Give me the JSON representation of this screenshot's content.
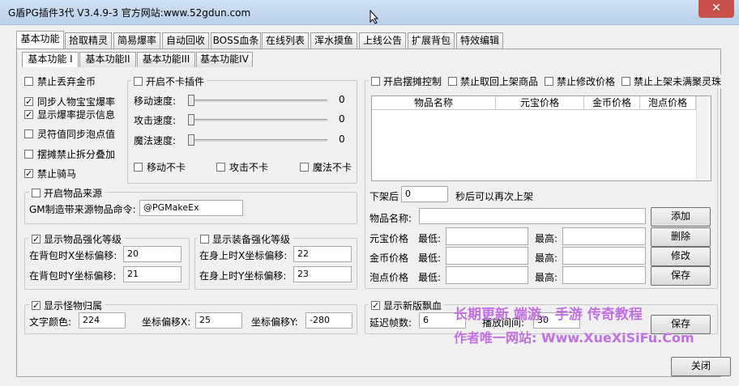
{
  "window": {
    "title": "G盾PG插件3代 V3.4.9-3  官方网站:www.52gdun.com",
    "close_label": "✕"
  },
  "main_tabs": [
    "基本功能",
    "拾取精灵",
    "简易爆率",
    "自动回收",
    "BOSS血条",
    "在线列表",
    "浑水摸鱼",
    "上线公告",
    "扩展背包",
    "特效编辑"
  ],
  "sub_tabs": [
    "基本功能 I",
    "基本功能II",
    "基本功能III",
    "基本功能IV"
  ],
  "basic_options": [
    {
      "label": "禁止丢弃金币",
      "checked": false
    },
    {
      "label": "同步人物宝宝爆率",
      "checked": true
    },
    {
      "label": "显示爆率提示信息",
      "checked": true
    },
    {
      "label": "灵符值同步泡点值",
      "checked": false
    },
    {
      "label": "摆摊禁止拆分叠加",
      "checked": false
    },
    {
      "label": "禁止骑马",
      "checked": true
    }
  ],
  "no_lag": {
    "legend": "开启不卡插件",
    "checked": false,
    "sliders": [
      {
        "label": "移动速度:",
        "value": "0"
      },
      {
        "label": "攻击速度:",
        "value": "0"
      },
      {
        "label": "魔法速度:",
        "value": "0"
      }
    ],
    "toggles": [
      {
        "label": "移动不卡",
        "checked": false
      },
      {
        "label": "攻击不卡",
        "checked": false
      },
      {
        "label": "魔法不卡",
        "checked": false
      }
    ]
  },
  "item_source": {
    "legend": "开启物品来源",
    "checked": false,
    "cmd_label": "GM制造带来源物品命令:",
    "cmd_value": "@PGMakeEx"
  },
  "item_enhance": {
    "legend": "显示物品强化等级",
    "checked": true,
    "x_label": "在背包时X坐标偏移:",
    "x_value": "20",
    "y_label": "在背包时Y坐标偏移:",
    "y_value": "21"
  },
  "equip_enhance": {
    "legend": "显示装备强化等级",
    "checked": false,
    "x_label": "在身上时X坐标偏移:",
    "x_value": "22",
    "y_label": "在身上时Y坐标偏移:",
    "y_value": "23"
  },
  "monster": {
    "legend": "显示怪物归属",
    "checked": true,
    "color_label": "文字颜色:",
    "color_value": "224",
    "x_label": "坐标偏移X:",
    "x_value": "25",
    "y_label": "坐标偏移Y:",
    "y_value": "-280"
  },
  "stall": {
    "options": [
      {
        "label": "开启摆摊控制",
        "checked": false
      },
      {
        "label": "禁止取回上架商品",
        "checked": false
      },
      {
        "label": "禁止修改价格",
        "checked": false
      },
      {
        "label": "禁止上架未满聚灵珠",
        "checked": false
      }
    ],
    "columns": [
      "物品名称",
      "元宝价格",
      "金币价格",
      "泡点价格"
    ],
    "delay_prefix": "下架后",
    "delay_value": "0",
    "delay_suffix": "秒后可以再次上架",
    "item_name_label": "物品名称:",
    "item_name_value": "",
    "price_rows": [
      {
        "label": "元宝价格"
      },
      {
        "label": "金币价格"
      },
      {
        "label": "泡点价格"
      }
    ],
    "min_label": "最低:",
    "max_label": "最高:",
    "buttons": [
      "添加",
      "删除",
      "修改",
      "保存"
    ]
  },
  "blood": {
    "legend": "显示新版飘血",
    "checked": true,
    "delay_label": "延迟帧数:",
    "delay_value": "6",
    "play_label": "播放间间:",
    "play_value": "30",
    "save_label": "保存"
  },
  "watermark": {
    "line1": "长期更新   端游、手游 传奇教程",
    "line2": "作者唯一网站: Www.XueXiSiFu.Com"
  },
  "footer": {
    "close_label": "关闭"
  }
}
